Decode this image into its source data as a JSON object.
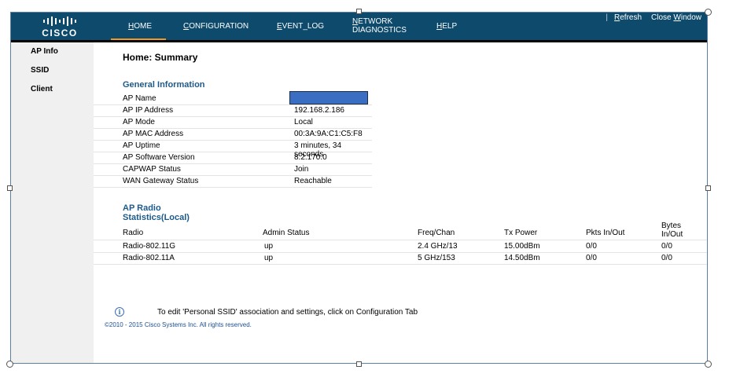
{
  "brand": {
    "logo_text": "CISCO"
  },
  "nav": [
    {
      "label": "HOME",
      "first": "H",
      "rest": "OME"
    },
    {
      "label": "CONFIGURATION",
      "first": "C",
      "rest": "ONFIGURATION"
    },
    {
      "label": "EVENT_LOG",
      "first": "E",
      "rest": "VENT_LOG"
    },
    {
      "label": "NETWORK DIAGNOSTICS",
      "first": "N",
      "rest": "ETWORK",
      "line2": "DIAGNOSTICS"
    },
    {
      "label": "HELP",
      "first": "H",
      "rest": "ELP"
    }
  ],
  "top_links": {
    "separator": "|",
    "refresh_first": "R",
    "refresh_rest": "efresh",
    "close_pre": "Close ",
    "close_first": "W",
    "close_rest": "indow"
  },
  "sidebar": {
    "items": [
      "AP Info",
      "SSID",
      "Client"
    ]
  },
  "main": {
    "title": "Home: Summary",
    "general_title": "General Information",
    "general": [
      {
        "key": "AP Name",
        "value": ""
      },
      {
        "key": "AP IP Address",
        "value": "192.168.2.186"
      },
      {
        "key": "AP Mode",
        "value": "Local"
      },
      {
        "key": "AP MAC Address",
        "value": "00:3A:9A:C1:C5:F8"
      },
      {
        "key": "AP Uptime",
        "value": "3 minutes, 34 seconds"
      },
      {
        "key": "AP Software Version",
        "value": "8.2.170.0"
      },
      {
        "key": "CAPWAP Status",
        "value": "Join"
      },
      {
        "key": "WAN Gateway Status",
        "value": "Reachable"
      }
    ],
    "radio_title_1": "AP Radio",
    "radio_title_2": "Statistics(Local)",
    "radio_headers": {
      "radio": "Radio",
      "admin": "Admin Status",
      "freq": "Freq/Chan",
      "tx": "Tx Power",
      "pkts": "Pkts In/Out",
      "bytes_1": "Bytes",
      "bytes_2": "In/Out"
    },
    "radios": [
      {
        "radio": "Radio-802.11G",
        "admin": "up",
        "freq": "2.4 GHz/13",
        "tx": "15.00dBm",
        "pkts": "0/0",
        "bytes": "0/0"
      },
      {
        "radio": "Radio-802.11A",
        "admin": "up",
        "freq": "5 GHz/153",
        "tx": "14.50dBm",
        "pkts": "0/0",
        "bytes": "0/0"
      }
    ],
    "notice_icon": "i",
    "notice": "To edit 'Personal SSID' association and settings, click on Configuration Tab",
    "copyright": "©2010 - 2015 Cisco Systems Inc. All rights reserved."
  },
  "colors": {
    "topbar": "#0d4a6b",
    "accent": "#f39a1e",
    "section": "#1d5a8a"
  }
}
